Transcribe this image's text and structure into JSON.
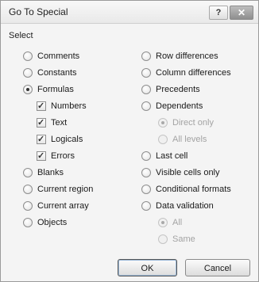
{
  "dialog": {
    "title": "Go To Special",
    "help_label": "?",
    "close_label": "✕",
    "section_label": "Select"
  },
  "left_options": [
    {
      "label": "Comments",
      "type": "radio",
      "checked": false,
      "enabled": true
    },
    {
      "label": "Constants",
      "type": "radio",
      "checked": false,
      "enabled": true
    },
    {
      "label": "Formulas",
      "type": "radio",
      "checked": true,
      "enabled": true
    },
    {
      "label": "Numbers",
      "type": "checkbox",
      "checked": true,
      "enabled": true
    },
    {
      "label": "Text",
      "type": "checkbox",
      "checked": true,
      "enabled": true
    },
    {
      "label": "Logicals",
      "type": "checkbox",
      "checked": true,
      "enabled": true
    },
    {
      "label": "Errors",
      "type": "checkbox",
      "checked": true,
      "enabled": true
    },
    {
      "label": "Blanks",
      "type": "radio",
      "checked": false,
      "enabled": true
    },
    {
      "label": "Current region",
      "type": "radio",
      "checked": false,
      "enabled": true
    },
    {
      "label": "Current array",
      "type": "radio",
      "checked": false,
      "enabled": true
    },
    {
      "label": "Objects",
      "type": "radio",
      "checked": false,
      "enabled": true
    }
  ],
  "right_options": [
    {
      "label": "Row differences",
      "type": "radio",
      "checked": false,
      "enabled": true
    },
    {
      "label": "Column differences",
      "type": "radio",
      "checked": false,
      "enabled": true
    },
    {
      "label": "Precedents",
      "type": "radio",
      "checked": false,
      "enabled": true
    },
    {
      "label": "Dependents",
      "type": "radio",
      "checked": false,
      "enabled": true
    },
    {
      "label": "Direct only",
      "type": "radio",
      "checked": true,
      "enabled": false
    },
    {
      "label": "All levels",
      "type": "radio",
      "checked": false,
      "enabled": false
    },
    {
      "label": "Last cell",
      "type": "radio",
      "checked": false,
      "enabled": true
    },
    {
      "label": "Visible cells only",
      "type": "radio",
      "checked": false,
      "enabled": true
    },
    {
      "label": "Conditional formats",
      "type": "radio",
      "checked": false,
      "enabled": true
    },
    {
      "label": "Data validation",
      "type": "radio",
      "checked": false,
      "enabled": true
    },
    {
      "label": "All",
      "type": "radio",
      "checked": true,
      "enabled": false
    },
    {
      "label": "Same",
      "type": "radio",
      "checked": false,
      "enabled": false
    }
  ],
  "buttons": {
    "ok_label": "OK",
    "cancel_label": "Cancel"
  }
}
